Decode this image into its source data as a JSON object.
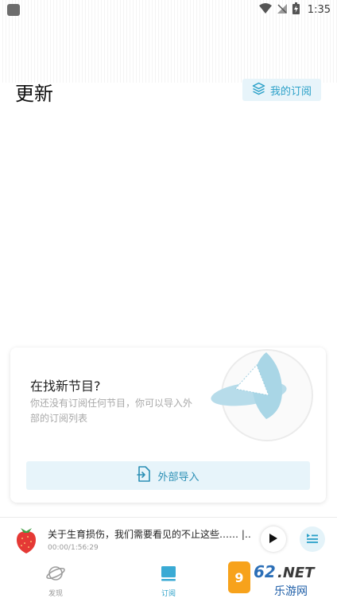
{
  "status_bar": {
    "time": "1:35"
  },
  "header": {
    "title": "更新",
    "my_subscriptions_label": "我的订阅"
  },
  "empty_card": {
    "title": "在找新节目?",
    "description": "你还没有订阅任何节目，你可以导入外部的订阅列表",
    "import_label": "外部导入"
  },
  "mini_player": {
    "title": "关于生育损伤，我们需要看见的不止这些…… |…",
    "time": "00:00/1:56:29"
  },
  "bottom_nav": {
    "items": [
      {
        "label": "发现",
        "icon": "planet-icon",
        "active": false
      },
      {
        "label": "订阅",
        "icon": "subscriptions-icon",
        "active": true
      }
    ]
  },
  "watermark": {
    "text": "962.NET",
    "subtext": "乐游网"
  },
  "colors": {
    "accent": "#2aa0c8",
    "accent_bg": "#e7f4fa",
    "strawberry": "#e53935"
  }
}
